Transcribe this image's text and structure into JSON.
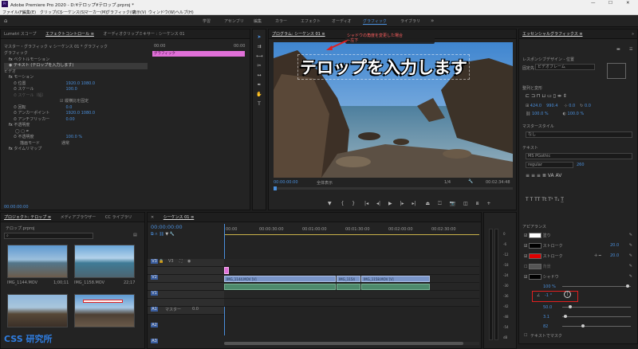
{
  "app": {
    "title": "Adobe Premiere Pro 2020 - D:¥テロップ¥テロップ.prproj *",
    "controls": [
      "—",
      "☐",
      "✕"
    ]
  },
  "menu": [
    "ファイル(F)",
    "編集(E)",
    "クリップ(C)",
    "シーケンス(S)",
    "マーカー(M)",
    "グラフィック(G)",
    "表示(V)",
    "ウィンドウ(W)",
    "ヘルプ(H)"
  ],
  "workspaces": [
    "学習",
    "アセンブリ",
    "編集",
    "カラー",
    "エフェクト",
    "オーディオ",
    "グラフィック",
    "ライブラリ"
  ],
  "workspace_active": "グラフィック",
  "effect_panel": {
    "tabs": [
      "Lumetri スコープ",
      "エフェクトコントロール ≡",
      "オーディオクリップミキサー : シーケンス 01"
    ],
    "source_row": "マスター・グラフィック ∨  シーケンス 01 * グラフィック",
    "timecode_start": "00:00",
    "timecode_end": "00:00",
    "clip_label": "グラフィック",
    "section_graphic": "グラフィック",
    "vector_motion": "ベクトルモーション",
    "text_layer": "テキスト (テロップを入力します)",
    "section_video": "ビデオ",
    "motion": "モーション",
    "rows": [
      {
        "label": "位置",
        "value": "1920.0   1080.0"
      },
      {
        "label": "スケール",
        "value": "100.0"
      },
      {
        "label": "スケール（幅）",
        "value": ""
      },
      {
        "label": "",
        "value": "縦横比を固定"
      },
      {
        "label": "回転",
        "value": "0.0"
      },
      {
        "label": "アンカーポイント",
        "value": "1920.0   1080.0"
      },
      {
        "label": "アンチフリッカー",
        "value": "0.00"
      }
    ],
    "opacity": "不透明度",
    "opacity_value": "100.0 %",
    "blend_mode_label": "描画モード",
    "blend_mode": "通常",
    "time_remap": "タイムリマップ",
    "timecode_bottom": "00:00:00:00"
  },
  "program": {
    "tab": "プログラム: シーケンス 01 ≡",
    "caption": "テロップを入力します",
    "annotation": "シャドウの角度を変更した場合\n←左下",
    "timecode": "00:00:00:00",
    "fit": "全体表示",
    "quality": "1/4",
    "duration": "00:02:34:48"
  },
  "project": {
    "tabs": [
      "プロジェクト: テロップ ≡",
      "メディアブラウザー",
      "CC ライブラリ"
    ],
    "file": "テロップ.prproj",
    "search_placeholder": "",
    "items": [
      {
        "name": "IMG_1144.MOV",
        "dur": "1;00;11"
      },
      {
        "name": "IMG_1158.MOV",
        "dur": "22;17"
      },
      {
        "name": "",
        "dur": ""
      },
      {
        "name": "",
        "dur": ""
      }
    ]
  },
  "timeline": {
    "tab": "シーケンス 01 ≡",
    "timecode": "00:00:00:00",
    "ruler": [
      "00:00",
      "00:00:30:00",
      "00:01:00:00",
      "00:01:30:00",
      "00:02:00:00",
      "00:02:30:00"
    ],
    "tracks": [
      "V3",
      "V2",
      "V1",
      "A1",
      "A2",
      "A3"
    ],
    "master": "マスター",
    "master_val": "0.0",
    "clips": [
      "IMG_1144.MOV [V]",
      "IMG_1154",
      "IMG_1158.MOV [V]"
    ],
    "meter_labels": [
      "0",
      "-6",
      "-12",
      "-18",
      "-24",
      "-30",
      "-36",
      "-42",
      "-48",
      "-54",
      "dB"
    ]
  },
  "essential": {
    "tab": "エッセンシャルグラフィックス ≡",
    "responsive_label": "レスポンシブデザイン - 位置",
    "pin_label": "固定先",
    "pin_value": "ビデオフレーム",
    "align_label": "整列と変形",
    "transform_vals": [
      "424.0",
      "990.4",
      "0.0",
      "100.0 %",
      "0.0",
      "100.0 %"
    ],
    "master_style": "マスタースタイル",
    "master_style_val": "なし",
    "text_label": "テキスト",
    "font": "MS PGothic",
    "font_style": "regular",
    "font_size": "260",
    "appearance": "アピアランス",
    "fill": "塗り",
    "stroke1": "ストローク",
    "stroke1_val": "20.0",
    "stroke2": "ストローク",
    "stroke2_val": "20.0",
    "bg": "背景",
    "shadow": "シャドウ",
    "shadow_opacity": "100 %",
    "shadow_angle": "-1 °",
    "shadow_distance": "50.0",
    "shadow_blur": "3.1",
    "shadow_size": "82",
    "text_mask": "テキストでマスク",
    "colors": {
      "fill": "#ffffff",
      "stroke1": "#000000",
      "stroke2": "#e00000",
      "bg": "#555555",
      "shadow": "#000000"
    }
  },
  "watermark": "CSS 研究所",
  "colors": {
    "accent": "#4a8fdc",
    "pink": "#e070d8",
    "highlight_red": "#e02020"
  }
}
